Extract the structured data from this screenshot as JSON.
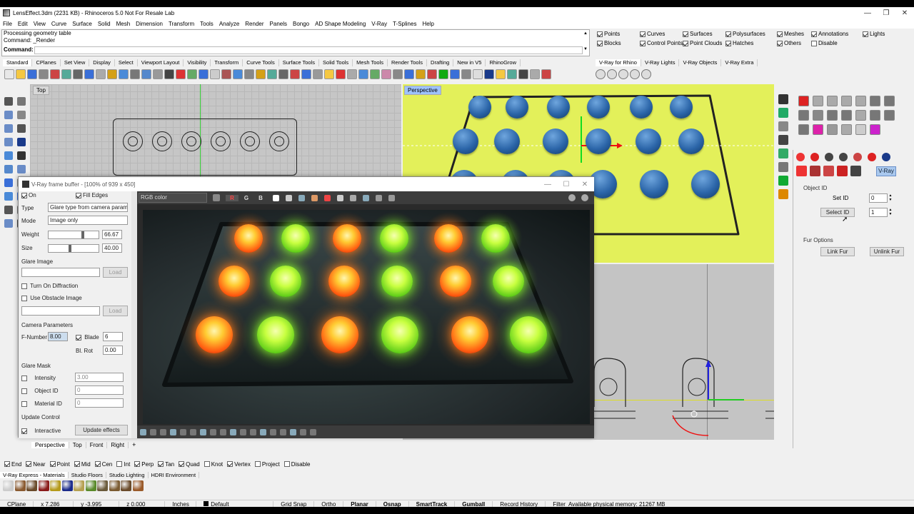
{
  "window": {
    "title": "LensEffect.3dm (2231 KB) - Rhinoceros 5.0 Not For Resale Lab",
    "controls": [
      "—",
      "❐",
      "✕"
    ]
  },
  "menu": [
    "File",
    "Edit",
    "View",
    "Curve",
    "Surface",
    "Solid",
    "Mesh",
    "Dimension",
    "Transform",
    "Tools",
    "Analyze",
    "Render",
    "Panels",
    "Bongo",
    "AD Shape Modeling",
    "V-Ray",
    "T-Splines",
    "Help"
  ],
  "command": {
    "history": [
      "Processing geometry table",
      "Command: _Render"
    ],
    "prompt": "Command:"
  },
  "filters": [
    {
      "label": "Points",
      "checked": true
    },
    {
      "label": "Curves",
      "checked": true
    },
    {
      "label": "Surfaces",
      "checked": true
    },
    {
      "label": "Polysurfaces",
      "checked": true
    },
    {
      "label": "Meshes",
      "checked": true
    },
    {
      "label": "Annotations",
      "checked": true
    },
    {
      "label": "Lights",
      "checked": true
    },
    {
      "label": "Blocks",
      "checked": true
    },
    {
      "label": "Control Points",
      "checked": true
    },
    {
      "label": "Point Clouds",
      "checked": true
    },
    {
      "label": "Hatches",
      "checked": true
    },
    {
      "label": "Others",
      "checked": true
    },
    {
      "label": "Disable",
      "checked": false
    }
  ],
  "toolbar_tabs": [
    "Standard",
    "CPlanes",
    "Set View",
    "Display",
    "Select",
    "Viewport Layout",
    "Visibility",
    "Transform",
    "Curve Tools",
    "Surface Tools",
    "Solid Tools",
    "Mesh Tools",
    "Render Tools",
    "Drafting",
    "New in V5",
    "RhinoGrow"
  ],
  "vray_tabs": [
    "V-Ray for Rhino",
    "V-Ray Lights",
    "V-Ray Objects",
    "V-Ray Extra"
  ],
  "viewports": {
    "top_label": "Top",
    "perspective_label": "Perspective"
  },
  "frame_buffer": {
    "title": "V-Ray frame buffer - [100% of 939 x 450]",
    "channel": "RGB color",
    "channel_buttons": [
      "R",
      "G",
      "B"
    ],
    "on_label": "On",
    "fill_edges_label": "Fill Edges",
    "type_label": "Type",
    "type_value": "Glare type from camera parameters",
    "mode_label": "Mode",
    "mode_value": "Image only",
    "weight_label": "Weight",
    "weight_value": "66.67",
    "size_label": "Size",
    "size_value": "40.00",
    "glare_image_label": "Glare Image",
    "load_label": "Load",
    "diffraction_label": "Turn On Diffraction",
    "obstacle_label": "Use Obstacle Image",
    "camera_params_label": "Camera Parameters",
    "fnumber_label": "F-Number",
    "fnumber_value": "8.00",
    "blade_label": "Blade",
    "blade_value": "6",
    "blrot_label": "Bl. Rot",
    "blrot_value": "0.00",
    "glare_mask_label": "Glare Mask",
    "intensity_label": "Intensity",
    "intensity_value": "3.00",
    "objectid_label": "Object ID",
    "objectid_value": "0",
    "materialid_label": "Material ID",
    "materialid_value": "0",
    "update_control_label": "Update Control",
    "interactive_label": "Interactive",
    "update_button": "Update effects"
  },
  "render_lights": {
    "rows": [
      [
        "orange",
        "green",
        "orange",
        "green",
        "orange",
        "green"
      ],
      [
        "orange",
        "green",
        "orange",
        "green",
        "orange",
        "green"
      ],
      [
        "orange",
        "green",
        "orange",
        "green",
        "orange",
        "green"
      ]
    ],
    "colors": {
      "orange": "#ff7a1a",
      "green": "#8cff2a"
    }
  },
  "object_id_panel": {
    "tab_label": "V-Ray",
    "section": "Object ID",
    "set_id_label": "Set ID",
    "set_id_value": "0",
    "select_id_button": "Select ID",
    "select_id_value": "1",
    "fur_section": "Fur Options",
    "link_fur": "Link Fur",
    "unlink_fur": "Unlink Fur"
  },
  "view_tabs": [
    "Perspective",
    "Top",
    "Front",
    "Right"
  ],
  "osnaps": [
    {
      "label": "End",
      "checked": true
    },
    {
      "label": "Near",
      "checked": true
    },
    {
      "label": "Point",
      "checked": true
    },
    {
      "label": "Mid",
      "checked": true
    },
    {
      "label": "Cen",
      "checked": true
    },
    {
      "label": "Int",
      "checked": false
    },
    {
      "label": "Perp",
      "checked": true
    },
    {
      "label": "Tan",
      "checked": true
    },
    {
      "label": "Quad",
      "checked": true
    },
    {
      "label": "Knot",
      "checked": false
    },
    {
      "label": "Vertex",
      "checked": true
    },
    {
      "label": "Project",
      "checked": false
    },
    {
      "label": "Disable",
      "checked": false
    }
  ],
  "material_tabs": [
    "V-Ray Express - Materials",
    "Studio Floors",
    "Studio Lighting",
    "HDRI Environment"
  ],
  "status": {
    "cplane": "CPlane",
    "x": "x 7.286",
    "y": "y -3.995",
    "z": "z 0.000",
    "units": "Inches",
    "layer": "Default",
    "grid_snap": "Grid Snap",
    "ortho": "Ortho",
    "planar": "Planar",
    "osnap": "Osnap",
    "smarttrack": "SmartTrack",
    "gumball": "Gumball",
    "record_history": "Record History",
    "filter": "Filter",
    "memory": "Available physical memory: 21267 MB"
  }
}
